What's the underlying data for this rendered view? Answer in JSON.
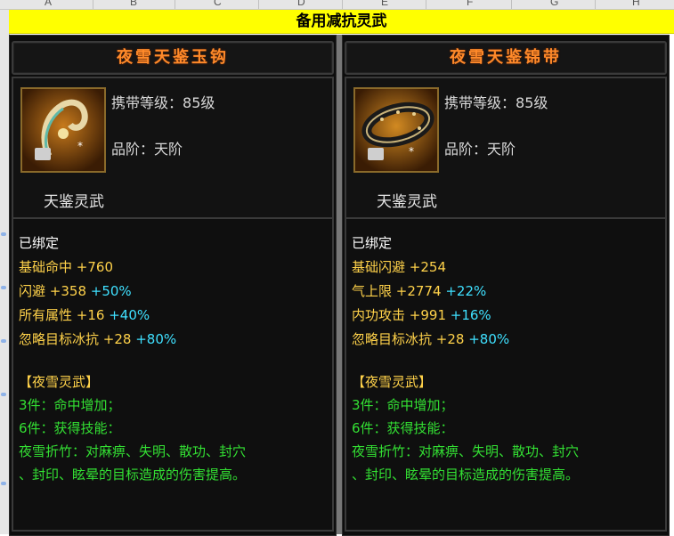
{
  "sheet": {
    "columns": [
      "A",
      "B",
      "C",
      "D",
      "E",
      "F",
      "G",
      "H"
    ],
    "banner": "备用减抗灵武"
  },
  "colors": {
    "title": "#ff8a2a",
    "stat_value": "#ffd24a",
    "percent": "#3fe0ff",
    "set_text": "#33e033",
    "banner_bg": "#ffff00"
  },
  "items": [
    {
      "name": "夜雪天鉴玉钩",
      "icon": "jade-hook-icon",
      "level_label": "携带等级：",
      "level_value": "85级",
      "grade_label": "品阶：",
      "grade_value": "天阶",
      "category": "天鉴灵武",
      "bound": "已绑定",
      "stats": [
        {
          "name": "基础命中",
          "value": "+760",
          "pct": ""
        },
        {
          "name": "闪避",
          "value": "+358",
          "pct": "+50%"
        },
        {
          "name": "所有属性",
          "value": "+16",
          "pct": "+40%"
        },
        {
          "name": "忽略目标冰抗",
          "value": "+28",
          "pct": "+80%"
        }
      ],
      "set_title": "【夜雪灵武】",
      "set_lines": [
        "3件：命中增加；",
        "6件：获得技能：",
        "夜雪折竹：对麻痹、失明、散功、封穴",
        "、封印、眩晕的目标造成的伤害提高。"
      ]
    },
    {
      "name": "夜雪天鉴锦带",
      "icon": "belt-icon",
      "level_label": "携带等级：",
      "level_value": "85级",
      "grade_label": "品阶：",
      "grade_value": "天阶",
      "category": "天鉴灵武",
      "bound": "已绑定",
      "stats": [
        {
          "name": "基础闪避",
          "value": "+254",
          "pct": ""
        },
        {
          "name": "气上限",
          "value": "+2774",
          "pct": "+22%"
        },
        {
          "name": "内功攻击",
          "value": "+991",
          "pct": "+16%"
        },
        {
          "name": "忽略目标冰抗",
          "value": "+28",
          "pct": "+80%"
        }
      ],
      "set_title": "【夜雪灵武】",
      "set_lines": [
        "3件：命中增加；",
        "6件：获得技能：",
        "夜雪折竹：对麻痹、失明、散功、封穴",
        "、封印、眩晕的目标造成的伤害提高。"
      ]
    }
  ]
}
